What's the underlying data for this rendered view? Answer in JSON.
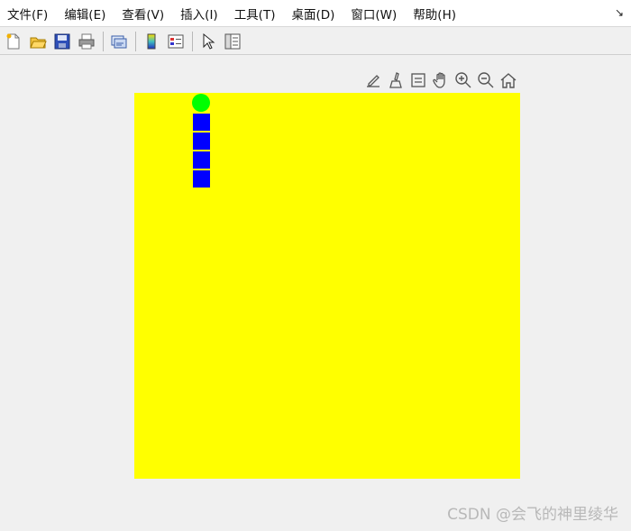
{
  "menu": {
    "items": [
      "文件(F)",
      "编辑(E)",
      "查看(V)",
      "插入(I)",
      "工具(T)",
      "桌面(D)",
      "窗口(W)",
      "帮助(H)"
    ],
    "corner_arrow": "↘"
  },
  "toolbar": {
    "buttons": [
      "new-figure-icon",
      "open-file-icon",
      "save-icon",
      "print-icon",
      "link-plot-icon",
      "colorbar-icon",
      "legend-icon",
      "pointer-icon",
      "property-inspector-icon"
    ]
  },
  "axes_toolbar": {
    "buttons": [
      "edit-plot-icon",
      "brush-icon",
      "data-tip-icon",
      "pan-hand-icon",
      "zoom-in-icon",
      "zoom-out-icon",
      "home-icon"
    ]
  },
  "plot": {
    "background_color": "#ffff00",
    "snake_head_color": "#00ff00",
    "snake_body_color": "#0000ff",
    "snake_body_segments": 4
  },
  "watermark": "CSDN @会飞的神里绫华"
}
